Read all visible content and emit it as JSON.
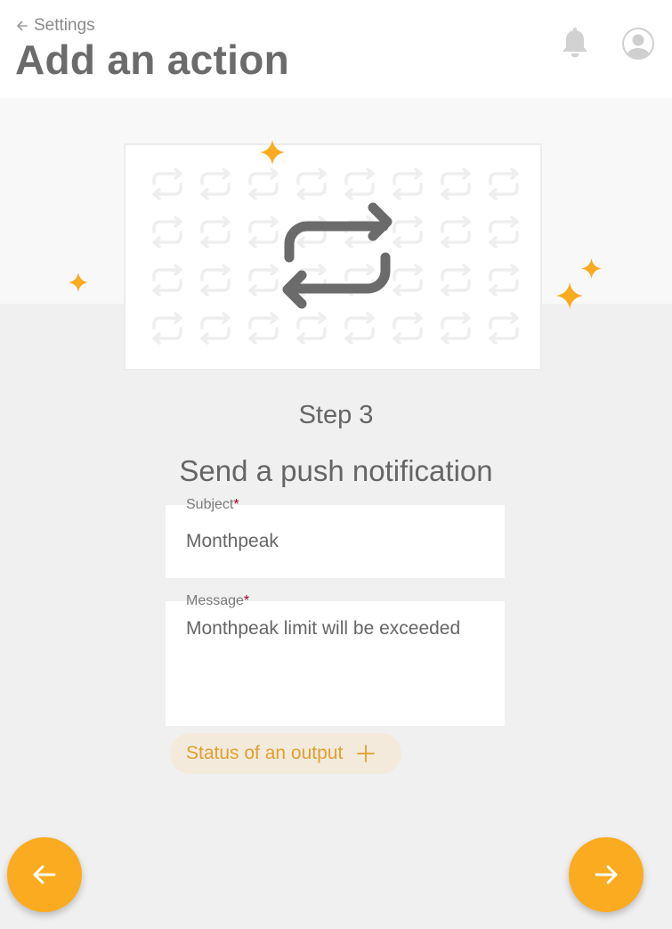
{
  "header": {
    "back_label": "Settings",
    "title": "Add an action"
  },
  "icons": {
    "back": "arrow-left-icon",
    "notifications": "bell-icon",
    "account": "user-avatar-icon",
    "illustration": "repeat-icon",
    "decoration": "sparkle-icon",
    "chip_add": "plus-icon",
    "prev": "arrow-left-icon",
    "next": "arrow-right-icon"
  },
  "step": {
    "label": "Step 3",
    "title": "Send a push notification"
  },
  "form": {
    "subject_label": "Subject",
    "subject_value": "Monthpeak",
    "message_label": "Message",
    "message_value": "Monthpeak limit will be exceeded",
    "required_marker": "*"
  },
  "chip": {
    "label": "Status of an output"
  },
  "colors": {
    "accent": "#fbab1f",
    "chip_bg": "#f3eadb",
    "chip_text": "#e0a030",
    "required": "#a00028",
    "title": "#6b6b6b",
    "icon_gray": "#6b6b6b",
    "background": "#f0f0f0"
  }
}
